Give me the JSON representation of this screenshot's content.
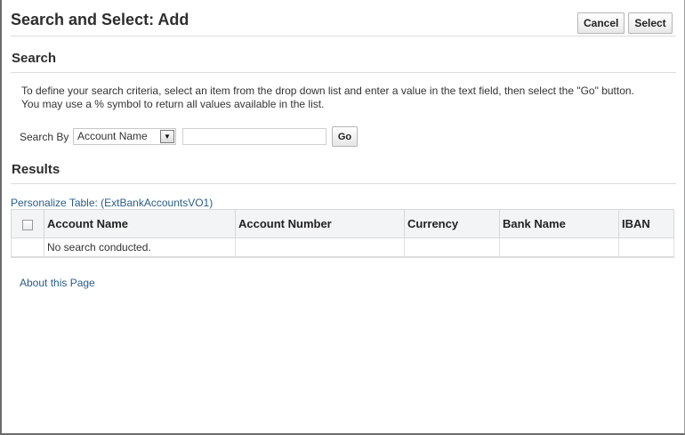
{
  "header": {
    "title": "Search and Select: Add",
    "cancel_label": "Cancel",
    "select_label": "Select"
  },
  "search": {
    "section_title": "Search",
    "instructions": "To define your search criteria, select an item from the drop down list and enter a value in the text field, then select the \"Go\" button.",
    "instructions_2": "You may use a % symbol to return all values available in the list.",
    "search_by_label": "Search By",
    "search_by_value": "Account Name",
    "value": "",
    "go_label": "Go"
  },
  "results": {
    "section_title": "Results",
    "personalize_label": "Personalize Table: (ExtBankAccountsVO1)",
    "columns": [
      "Account Name",
      "Account Number",
      "Currency",
      "Bank Name",
      "IBAN"
    ],
    "empty_message": "No search conducted."
  },
  "footer": {
    "about_label": "About this Page"
  }
}
